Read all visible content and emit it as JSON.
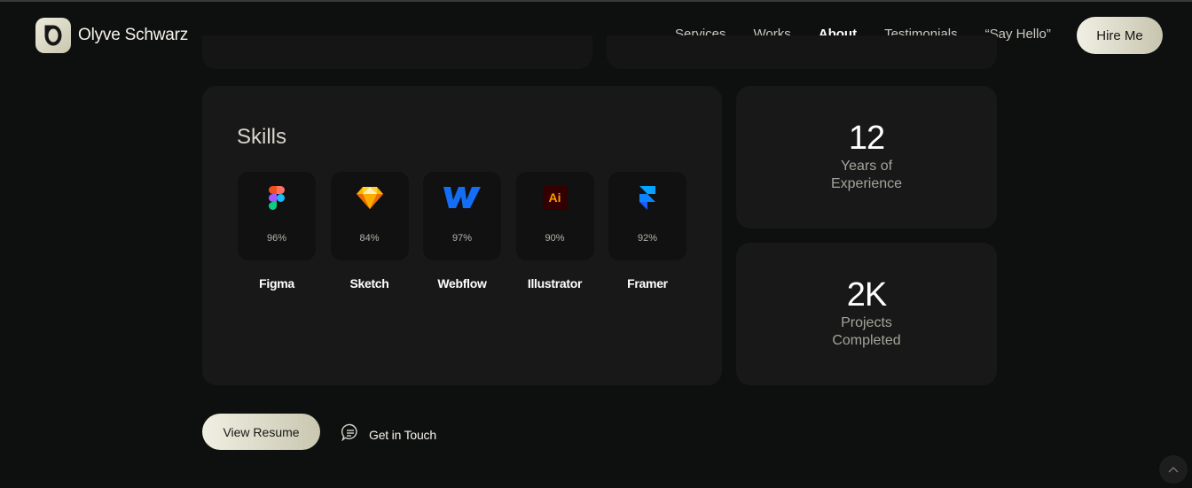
{
  "header": {
    "brand_name": "Olyve Schwarz",
    "nav": [
      {
        "label": "Services",
        "active": false
      },
      {
        "label": "Works",
        "active": false
      },
      {
        "label": "About",
        "active": true
      },
      {
        "label": "Testimonials",
        "active": false
      },
      {
        "label": "“Say Hello”",
        "active": false
      }
    ],
    "hire_label": "Hire Me"
  },
  "skills": {
    "title": "Skills",
    "items": [
      {
        "name": "Figma",
        "percent": "96%",
        "icon": "figma-icon"
      },
      {
        "name": "Sketch",
        "percent": "84%",
        "icon": "sketch-icon"
      },
      {
        "name": "Webflow",
        "percent": "97%",
        "icon": "webflow-icon"
      },
      {
        "name": "Illustrator",
        "percent": "90%",
        "icon": "illustrator-icon",
        "icon_text": "Ai"
      },
      {
        "name": "Framer",
        "percent": "92%",
        "icon": "framer-icon"
      }
    ]
  },
  "stats": [
    {
      "value": "12",
      "label": "Years of Experience"
    },
    {
      "value": "2K",
      "label": "Projects Completed"
    }
  ],
  "actions": {
    "resume_label": "View Resume",
    "touch_label": "Get in Touch"
  },
  "colors": {
    "background": "#0e0f0f",
    "card": "#181818",
    "accent_button": "#e6e4d3"
  }
}
